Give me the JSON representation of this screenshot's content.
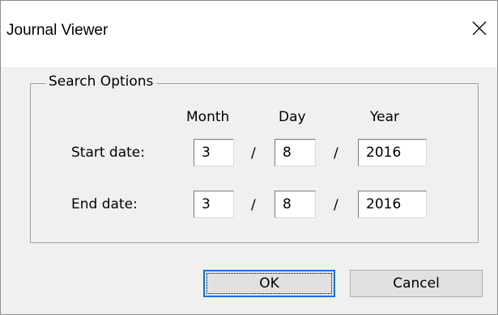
{
  "window": {
    "title": "Journal Viewer"
  },
  "group": {
    "legend": "Search Options"
  },
  "columns": {
    "month": "Month",
    "day": "Day",
    "year": "Year"
  },
  "separator": "/",
  "start_date": {
    "label": "Start date:",
    "month": "3",
    "day": "8",
    "year": "2016"
  },
  "end_date": {
    "label": "End date:",
    "month": "3",
    "day": "8",
    "year": "2016"
  },
  "buttons": {
    "ok": "OK",
    "cancel": "Cancel"
  },
  "icons": {
    "close": "close-icon"
  }
}
